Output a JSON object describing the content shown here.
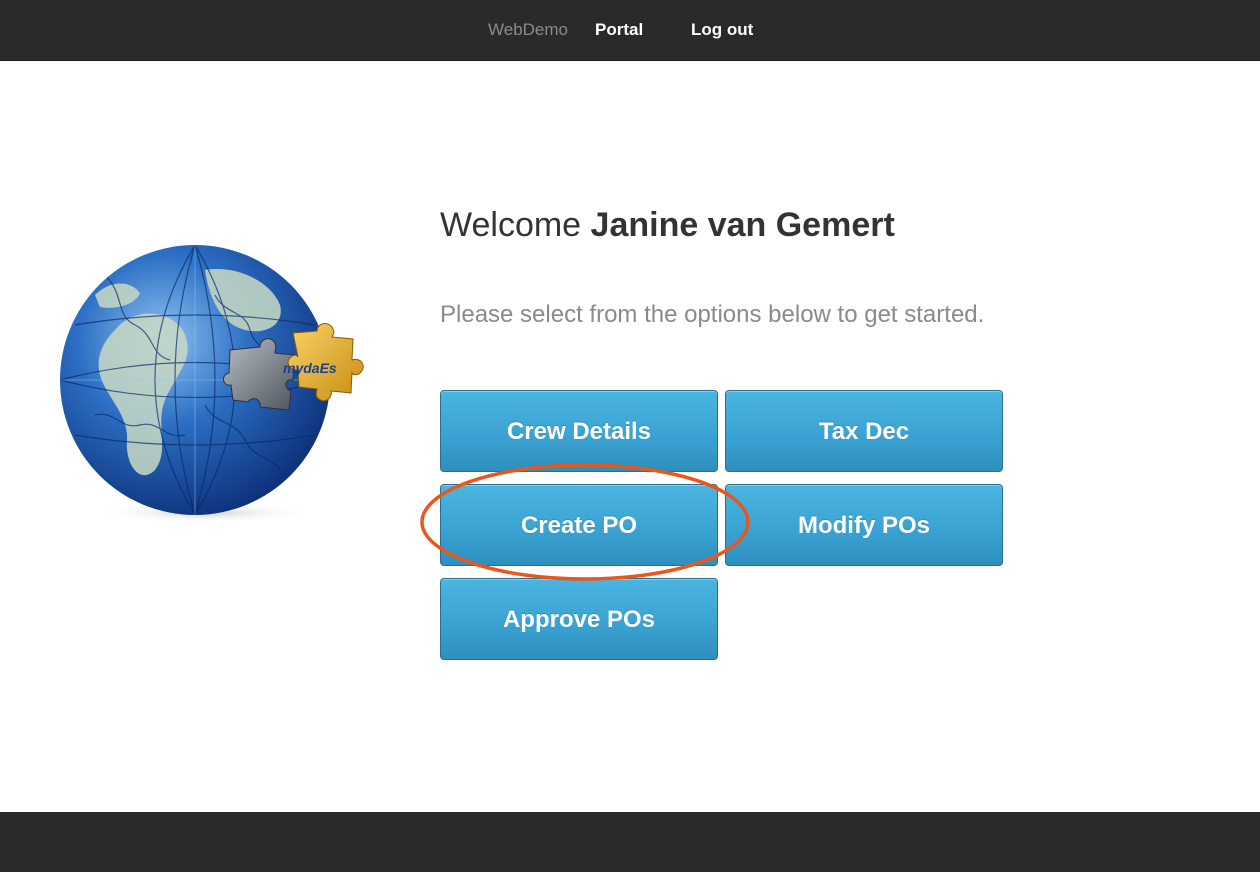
{
  "navbar": {
    "brand": "WebDemo",
    "links": [
      {
        "label": "Portal"
      },
      {
        "label": "Log out"
      }
    ]
  },
  "logo": {
    "text": "mydaEs"
  },
  "main": {
    "welcome_prefix": "Welcome",
    "user_name": "Janine van Gemert",
    "subtitle": "Please select from the options below to get started.",
    "buttons": [
      {
        "label": "Crew Details"
      },
      {
        "label": "Tax Dec"
      },
      {
        "label": "Create PO"
      },
      {
        "label": "Modify POs"
      },
      {
        "label": "Approve POs"
      }
    ]
  },
  "colors": {
    "navbar_bg": "#2a2a2a",
    "button_blue": "#3aa3d3",
    "highlight_orange": "#e8571c"
  }
}
